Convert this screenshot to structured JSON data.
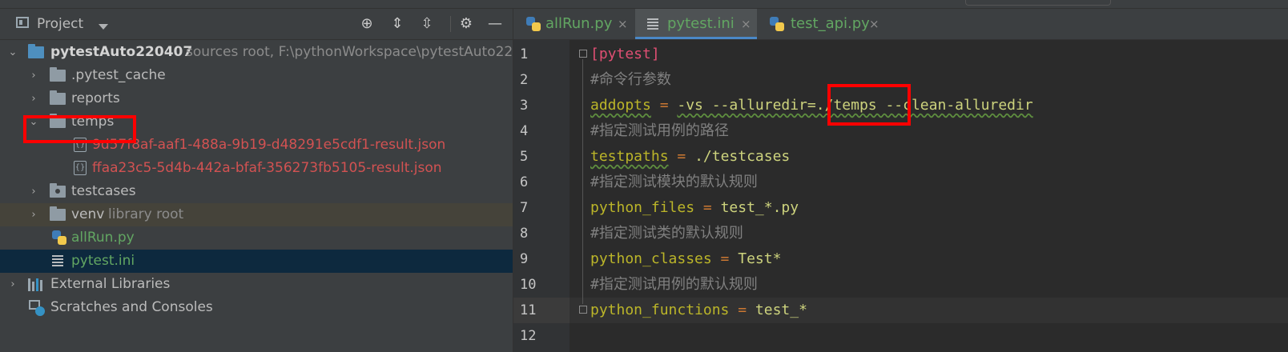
{
  "project": {
    "title": "Project",
    "tree": [
      {
        "name": "pytestAuto220407",
        "hint": "sources root,  F:\\pythonWorkspace\\pytestAuto22"
      },
      {
        "name": ".pytest_cache"
      },
      {
        "name": "reports"
      },
      {
        "name": "temps"
      },
      {
        "name": "9d57f8af-aaf1-488a-9b19-d48291e5cdf1-result.json"
      },
      {
        "name": "ffaa23c5-5d4b-442a-bfaf-356273fb5105-result.json"
      },
      {
        "name": "testcases"
      },
      {
        "name": "venv",
        "hint": "library root"
      },
      {
        "name": "allRun.py"
      },
      {
        "name": "pytest.ini"
      },
      {
        "name": "External Libraries"
      },
      {
        "name": "Scratches and Consoles"
      }
    ]
  },
  "tabs": [
    {
      "label": "allRun.py"
    },
    {
      "label": "pytest.ini",
      "active": true
    },
    {
      "label": "test_api.py"
    }
  ],
  "tab_close_glyph": "×",
  "editor": {
    "line_numbers": [
      "1",
      "2",
      "3",
      "4",
      "5",
      "6",
      "7",
      "8",
      "9",
      "10",
      "11",
      "12"
    ],
    "lines": [
      {
        "section": "[pytest]"
      },
      {
        "comment": "#命令行参数"
      },
      {
        "key": "addopts",
        "eq": " = ",
        "value": "-vs --alluredir=./temps --clean-alluredir"
      },
      {
        "comment": "#指定测试用例的路径"
      },
      {
        "key": "testpaths",
        "eq": " = ",
        "value": "./testcases"
      },
      {
        "comment": "#指定测试模块的默认规则"
      },
      {
        "key": "python_files",
        "eq": " = ",
        "value": "test_*.py"
      },
      {
        "comment": "#指定测试类的默认规则"
      },
      {
        "key": "python_classes",
        "eq": " = ",
        "value": "Test*"
      },
      {
        "comment": "#指定测试用例的默认规则"
      },
      {
        "key": "python_functions",
        "eq": " = ",
        "value": "test_*"
      },
      {}
    ]
  },
  "colors": {
    "highlight_box": "#ff0000",
    "accent": "#4a88c7"
  }
}
